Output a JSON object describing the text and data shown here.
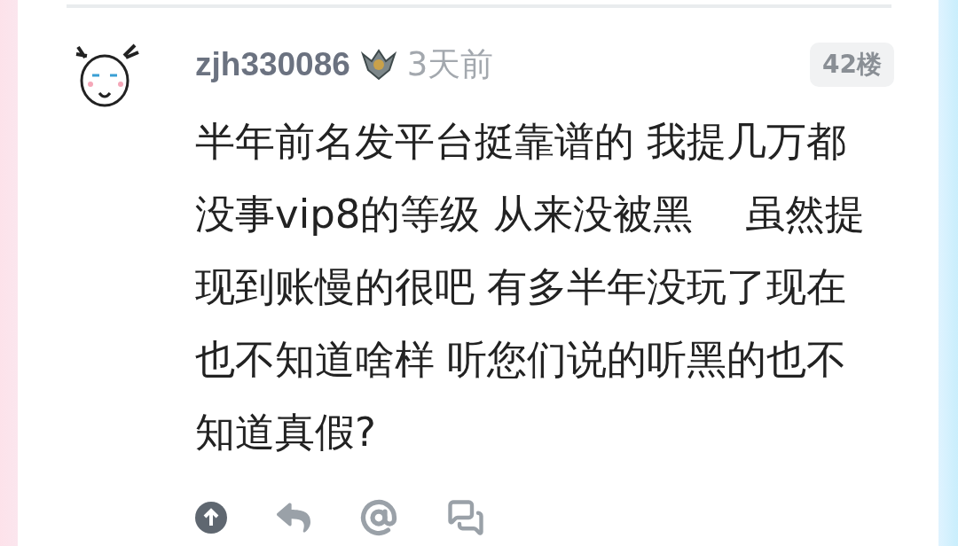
{
  "comment": {
    "username": "zjh330086",
    "time": "3天前",
    "floor": "42楼",
    "body": "半年前名发平台挺靠谱的 我提几万都没事vip8的等级 从来没被黑　 虽然提现到账慢的很吧 有多半年没玩了现在也不知道啥样 听您们说的听黑的也不知道真假?",
    "upvoted": true
  }
}
